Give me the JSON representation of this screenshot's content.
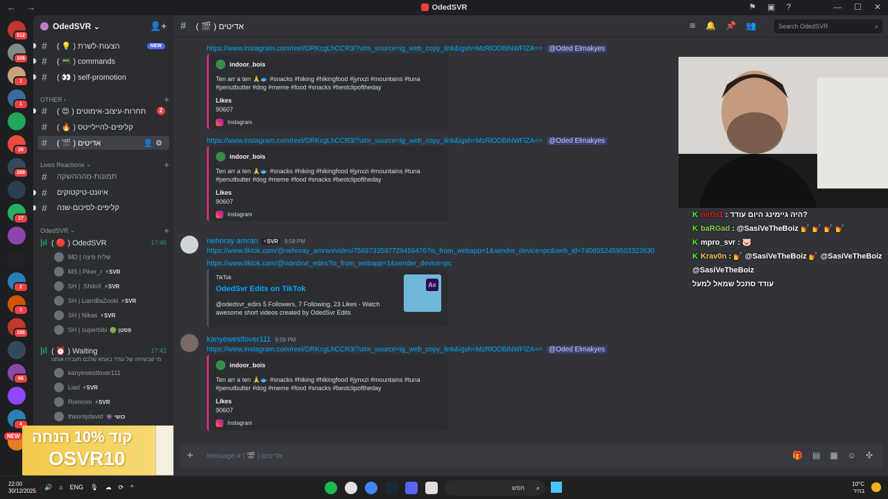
{
  "window": {
    "title": "OdedSVR",
    "nav": "← →"
  },
  "servers": [
    {
      "badge": "512",
      "color": "#c0392b"
    },
    {
      "badge": "106",
      "color": "#7f8c8d"
    },
    {
      "badge": "1",
      "color": "#c9a27e"
    },
    {
      "badge": "1",
      "color": "#3a6b9f"
    },
    {
      "badge": "",
      "color": "#23a55a"
    },
    {
      "badge": "28",
      "color": "#e74c3c"
    },
    {
      "badge": "299",
      "color": "#34495e"
    },
    {
      "badge": "",
      "color": "#2c3e50"
    },
    {
      "badge": "17",
      "color": "#27ae60"
    },
    {
      "badge": "",
      "color": "#8e44ad"
    },
    {
      "badge": "",
      "color": "#222"
    },
    {
      "badge": "2",
      "color": "#2980b9"
    },
    {
      "badge": "3",
      "color": "#d35400"
    },
    {
      "badge": "155",
      "color": "#c0392b"
    },
    {
      "badge": "",
      "color": "#34495e"
    },
    {
      "badge": "66",
      "color": "#8e44ad"
    },
    {
      "badge": "",
      "color": "#9146ff"
    },
    {
      "badge": "4",
      "color": "#2980b9"
    },
    {
      "badge": "",
      "color": "#e67e22"
    }
  ],
  "sidebar": {
    "guild_name": "OdedSVR",
    "channels_top": [
      {
        "label": "( 💡 ) הצעות-לשרת",
        "tag": "NEW"
      },
      {
        "label": "( 📟 ) commands"
      },
      {
        "label": "( 👀 ) self-promotion"
      }
    ],
    "cat_other": "OTHER",
    "channels_other": [
      {
        "label": "( 😍 ) תחרות-עיצוב-אימוטים",
        "count": "2"
      },
      {
        "label": "( 🔥 ) קליפים-להיילייטס"
      },
      {
        "label": "( 🎬 ) אדיטים"
      }
    ],
    "cat_lives": "Lives Reactions",
    "channels_lives": [
      {
        "label": "תמונות-מהההשקה"
      },
      {
        "label": "איוונט-טיקטוקים"
      },
      {
        "label": "קליפים-לסיכום-שנה"
      }
    ],
    "cat_voice": "OdedSVR",
    "voice1": {
      "label": "( 🔴 ) OdedSVR",
      "time": "17:46"
    },
    "voice1_users": [
      {
        "name": "MD | שליח פיצה",
        "tag": ""
      },
      {
        "name": "MS | Piker_r",
        "tag": "⚡SVR"
      },
      {
        "name": "SH | .ShiloX",
        "tag": "⚡SVR"
      },
      {
        "name": "SH | LiamBaZooki",
        "tag": "⚡SVR"
      },
      {
        "name": "SH | Nikas",
        "tag": "⚡SVR"
      },
      {
        "name": "SH | superbibi",
        "tag": "🟢 פסטן"
      }
    ],
    "voice2": {
      "label": "( ⏰ ) Waiting",
      "time": "17:42"
    },
    "voice2_note": "מי שבשיחה של עודד באמא שלכם תעבירו אותנו",
    "voice2_users": [
      {
        "name": "kanyewestlover111",
        "tag": ""
      },
      {
        "name": "Liad",
        "tag": "⚡SVR"
      },
      {
        "name": "Romrom",
        "tag": "⚡SVR"
      },
      {
        "name": "theonlydavid",
        "tag": "👾 כושי"
      }
    ]
  },
  "promo": {
    "line1": "קוד 10% הנחה",
    "line2": "OSVR10",
    "new": "NEW"
  },
  "header": {
    "channel": "( 🎬 ) אדיטים",
    "search_placeholder": "Search OdedSVR"
  },
  "messages": {
    "ig_link": "https://www.instagram.com/reel/DRKcgLhCCR3/?utm_source=ig_web_copy_link&igsh=MzRlODBiNWFlZA==",
    "mention": "@Oded Elmakyes",
    "embed": {
      "author": "indoor_bois",
      "desc": "Ten arr a ten 🙏🐟 #snacks #hiking #hikingfood #jynxzi #mountains #tuna #penutbutter #dog #meme #food #snacks #bestclipoftheday",
      "field_name": "Likes",
      "field_value": "90607",
      "footer": "Instagram"
    },
    "m3": {
      "user": "nehoray amran",
      "tag": "⚡SVR",
      "time": "9:58 PM",
      "link1": "https://www.tiktok.com/@nehoray_amran/video/7589733597729459476?is_from_webapp=1&sender_device=pc&web_id=7408552459503322630",
      "link2": "https://www.tiktok.com/@odedsvr_edirs?is_from_webapp=1&sender_device=pc",
      "embed_provider": "TikTok",
      "embed_title": "OdedSvr Edits on TikTok",
      "embed_desc": "@odedsvr_edirs 5 Followers, 7 Following, 23 Likes - Watch awesome short videos created by OdedSvr Edits"
    },
    "m4": {
      "user": "kanyewestlover111",
      "time": "9:59 PM"
    }
  },
  "composer": {
    "placeholder": "Message # ( 🎬 ) אדיטים"
  },
  "stream_chat": [
    {
      "user": "nir0s1",
      "text": ": היה גיימינג היום עודד?"
    },
    {
      "user": "baRGad",
      "text": ": @SasiVeTheBoiz 💅 💅 💅 💅"
    },
    {
      "user": "mpro_svr",
      "text": ": 🐷"
    },
    {
      "user": "Krav0n",
      "text": ": 💅 @SasiVeTheBoiz 💅 @SasiVeTheBoiz"
    },
    {
      "user": "",
      "text": "@SasiVeTheBoiz"
    },
    {
      "user": "",
      "text": "עודד סתכל שמאל למעל"
    }
  ],
  "taskbar": {
    "time": "22:00",
    "date": "30/12/2025",
    "lang": "ENG",
    "search": "חפש",
    "temp": "10°C",
    "weather": "בהיר"
  }
}
